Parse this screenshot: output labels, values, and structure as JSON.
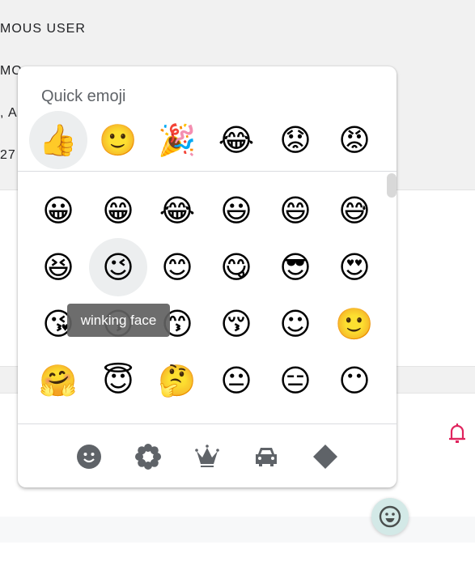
{
  "background": {
    "lines": [
      "MOUS USER",
      "MO",
      ", A",
      "27"
    ]
  },
  "picker": {
    "quick_title": "Quick emoji",
    "quick_emojis": [
      {
        "char": "👍",
        "name": "thumbs up",
        "selected": true
      },
      {
        "char": "🙂",
        "name": "slightly smiling face"
      },
      {
        "char": "🎉",
        "name": "party popper"
      },
      {
        "char": "😂",
        "name": "face with tears of joy"
      },
      {
        "char": "😟",
        "name": "worried face"
      },
      {
        "char": "😡",
        "name": "pouting face"
      }
    ],
    "grid_rows": [
      [
        "😀",
        "😁",
        "😂",
        "😃",
        "😄",
        "😅"
      ],
      [
        "😆",
        "😉",
        "😊",
        "😋",
        "😎",
        "😍"
      ],
      [
        "😘",
        "😗",
        "😙",
        "😚",
        "☺",
        "🙂"
      ],
      [
        "🤗",
        "😇",
        "🤔",
        "😐",
        "😑",
        "😶"
      ]
    ],
    "hovered_emoji": "😉",
    "tooltip": "winking face",
    "categories": [
      {
        "name": "smileys",
        "icon": "smiley-icon"
      },
      {
        "name": "nature",
        "icon": "flower-icon"
      },
      {
        "name": "objects",
        "icon": "crown-icon"
      },
      {
        "name": "travel",
        "icon": "car-icon"
      },
      {
        "name": "symbols",
        "icon": "diamond-icon"
      }
    ]
  },
  "colors": {
    "category_icon": "#5f6368",
    "bell": "#e0245e",
    "fab_bg": "#d3e9e7",
    "fab_icon": "#4a4f4e"
  }
}
